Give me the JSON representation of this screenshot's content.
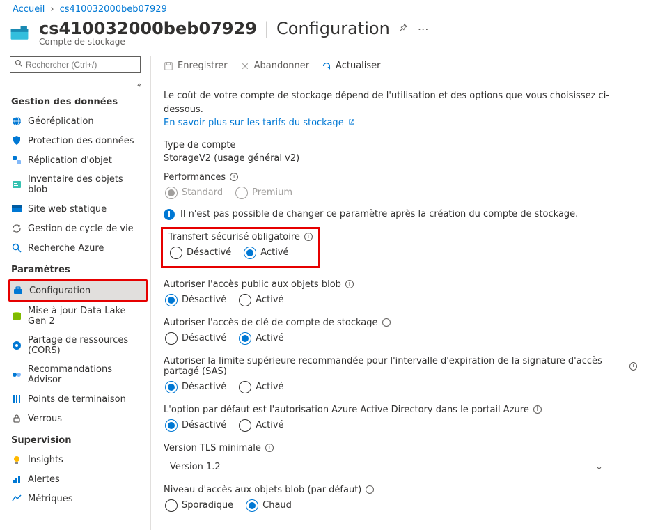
{
  "breadcrumb": {
    "home": "Accueil",
    "resource": "cs410032000beb07929"
  },
  "header": {
    "title": "cs410032000beb07929",
    "page": "Configuration",
    "subtitle": "Compte de stockage"
  },
  "search": {
    "placeholder": "Rechercher (Ctrl+/)"
  },
  "sidebar": {
    "section_data": "Gestion des données",
    "data_items": [
      {
        "label": "Géoréplication"
      },
      {
        "label": "Protection des données"
      },
      {
        "label": "Réplication d'objet"
      },
      {
        "label": "Inventaire des objets blob"
      },
      {
        "label": "Site web statique"
      },
      {
        "label": "Gestion de cycle de vie"
      },
      {
        "label": "Recherche Azure"
      }
    ],
    "section_settings": "Paramètres",
    "settings_items": [
      {
        "label": "Configuration"
      },
      {
        "label": "Mise à jour Data Lake Gen 2"
      },
      {
        "label": "Partage de ressources (CORS)"
      },
      {
        "label": "Recommandations Advisor"
      },
      {
        "label": "Points de terminaison"
      },
      {
        "label": "Verrous"
      }
    ],
    "section_supervision": "Supervision",
    "supervision_items": [
      {
        "label": "Insights"
      },
      {
        "label": "Alertes"
      },
      {
        "label": "Métriques"
      }
    ]
  },
  "toolbar": {
    "save": "Enregistrer",
    "discard": "Abandonner",
    "refresh": "Actualiser"
  },
  "intro": {
    "text": "Le coût de votre compte de stockage dépend de l'utilisation et des options que vous choisissez ci-dessous.",
    "link": "En savoir plus sur les tarifs du stockage"
  },
  "fields": {
    "account_type_label": "Type de compte",
    "account_type_value": "StorageV2 (usage général v2)",
    "performance_label": "Performances",
    "performance_options": [
      "Standard",
      "Premium"
    ],
    "performance_selected": "Standard",
    "locked_note": "Il n'est pas possible de changer ce paramètre après la création du compte de stockage.",
    "secure_transfer_label": "Transfert sécurisé obligatoire",
    "options_disable": "Désactivé",
    "options_enable": "Activé",
    "secure_transfer_selected": "Activé",
    "public_blob_label": "Autoriser l'accès public aux objets blob",
    "public_blob_selected": "Désactivé",
    "key_access_label": "Autoriser l'accès de clé de compte de stockage",
    "key_access_selected": "Activé",
    "sas_label": "Autoriser la limite supérieure recommandée pour l'intervalle d'expiration de la signature d'accès partagé (SAS)",
    "sas_selected": "Désactivé",
    "aad_label": "L'option par défaut est l'autorisation Azure Active Directory dans le portail Azure",
    "aad_selected": "Désactivé",
    "tls_label": "Version TLS minimale",
    "tls_value": "Version 1.2",
    "blob_tier_label": "Niveau d'accès aux objets blob (par défaut)",
    "blob_tier_options": [
      "Sporadique",
      "Chaud"
    ],
    "blob_tier_selected": "Chaud"
  }
}
